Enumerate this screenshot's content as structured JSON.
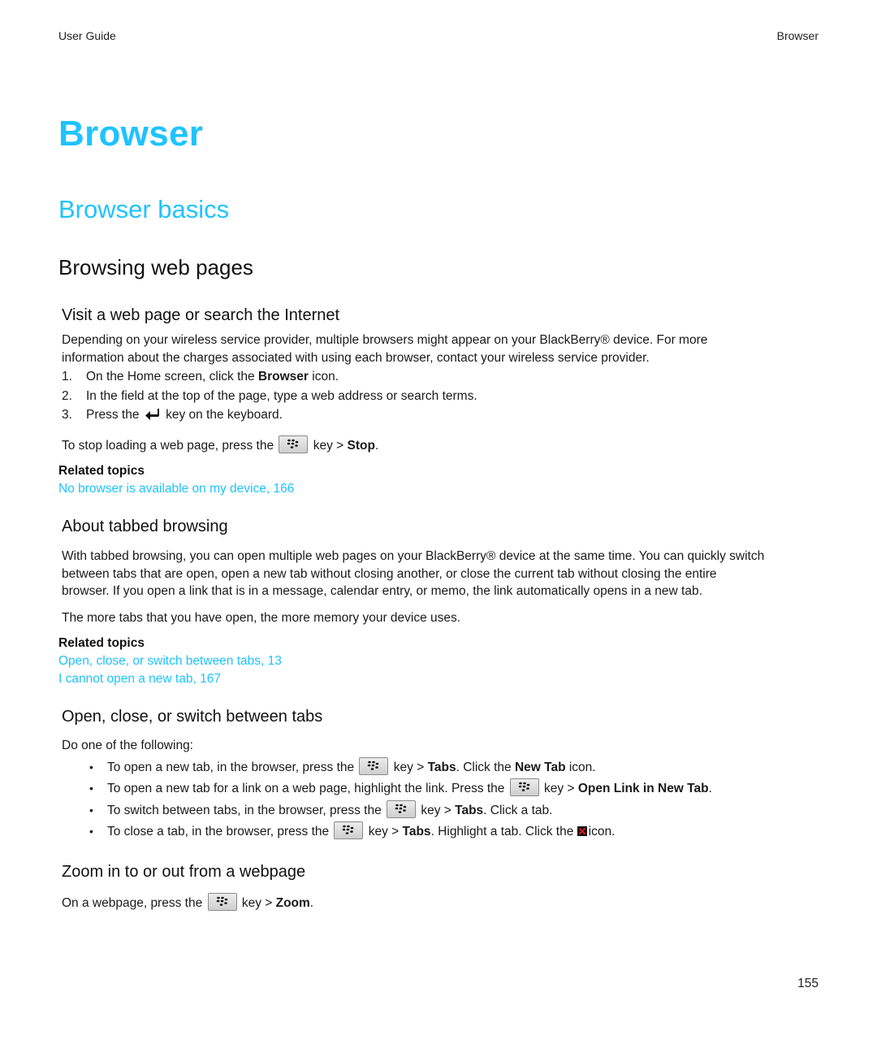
{
  "header": {
    "left": "User Guide",
    "right": "Browser"
  },
  "title": "Browser",
  "section": "Browser basics",
  "subsection": "Browsing web pages",
  "visit": {
    "heading": "Visit a web page or search the Internet",
    "intro_line1": "Depending on your wireless service provider, multiple browsers might appear on your BlackBerry® device. For more",
    "intro_line2": "information about the charges associated with using each browser, contact your wireless service provider.",
    "steps": [
      {
        "num": "1.",
        "pre": "On the Home screen, click the ",
        "bold": "Browser",
        "post": " icon."
      },
      {
        "num": "2.",
        "pre": "In the field at the top of the page, type a web address or search terms."
      },
      {
        "num": "3.",
        "pre": "Press the ",
        "icon": "enter-key-icon",
        "post": " key on the keyboard."
      }
    ],
    "stop_pre": "To stop loading a web page, press the ",
    "stop_mid": " key > ",
    "stop_bold": "Stop",
    "stop_post": ".",
    "related_label": "Related topics",
    "related": [
      "No browser is available on my device, 166"
    ]
  },
  "tabbed": {
    "heading": "About tabbed browsing",
    "para_lines": [
      "With tabbed browsing, you can open multiple web pages on your BlackBerry® device at the same time. You can quickly switch",
      "between tabs that are open, open a new tab without closing another, or close the current tab without closing the entire",
      "browser. If you open a link that is in a message, calendar entry, or memo, the link automatically opens in a new tab."
    ],
    "memory": "The more tabs that you have open, the more memory your device uses.",
    "related_label": "Related topics",
    "related": [
      "Open, close, or switch between tabs, 13",
      "I cannot open a new tab, 167"
    ]
  },
  "switch": {
    "heading": "Open, close, or switch between tabs",
    "intro": "Do one of the following:",
    "bullets": [
      {
        "pre": "To open a new tab, in the browser, press the ",
        "mid": " key > ",
        "b1": "Tabs",
        "t2": ". Click the ",
        "b2": "New Tab",
        "t3": " icon."
      },
      {
        "pre": "To open a new tab for a link on a web page, highlight the link. Press the ",
        "mid": " key > ",
        "b1": "Open Link in New Tab",
        "t2": "."
      },
      {
        "pre": "To switch between tabs, in the browser, press the ",
        "mid": " key > ",
        "b1": "Tabs",
        "t2": ". Click a tab."
      },
      {
        "pre": "To close a tab, in the browser, press the ",
        "mid": " key > ",
        "b1": "Tabs",
        "t2": ". Highlight a tab. Click the ",
        "t3": "icon."
      }
    ]
  },
  "zoom": {
    "heading": "Zoom in to or out from a webpage",
    "pre": "On a webpage, press the ",
    "mid": " key > ",
    "bold": "Zoom",
    "post": "."
  },
  "page_number": "155",
  "colors": {
    "heading_blue": "#1ec3ff",
    "link_blue": "#1ec3ff",
    "close_icon_red": "#e0141e"
  }
}
